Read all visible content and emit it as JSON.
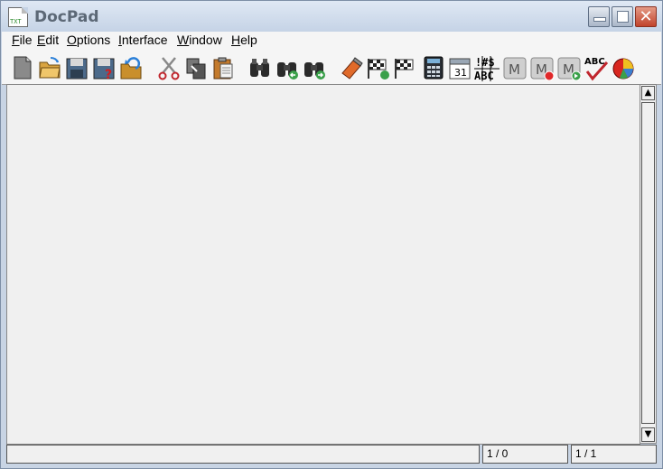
{
  "window": {
    "title": "DocPad",
    "app_icon_text": "TXT"
  },
  "menu": [
    {
      "label": "File",
      "accel": "F",
      "rest": "ile"
    },
    {
      "label": "Edit",
      "accel": "E",
      "rest": "dit"
    },
    {
      "label": "Options",
      "accel": "O",
      "rest": "ptions"
    },
    {
      "label": "Interface",
      "accel": "I",
      "rest": "nterface"
    },
    {
      "label": "Window",
      "accel": "W",
      "rest": "indow"
    },
    {
      "label": "Help",
      "accel": "H",
      "rest": "elp"
    }
  ],
  "toolbar": {
    "icons": [
      "new-document-icon",
      "open-folder-icon",
      "save-icon",
      "save-as-icon",
      "reload-icon",
      "cut-icon",
      "copy-icon",
      "paste-icon",
      "find-icon",
      "find-previous-icon",
      "find-next-icon",
      "eraser-icon",
      "goto-flag-icon",
      "flag-icon",
      "calculator-icon",
      "calendar-icon",
      "character-map-icon",
      "macro-icon",
      "macro-record-icon",
      "macro-play-icon",
      "spellcheck-icon",
      "pie-chart-icon"
    ],
    "calendar_day": "31",
    "charmap_top": "!#$",
    "charmap_bottom": "ABC",
    "macro_letter": "M",
    "spell_text": "ABC"
  },
  "statusbar": {
    "message": "",
    "position": "1 / 0",
    "page": "1 / 1"
  },
  "scrollbar": {
    "up_arrow": "▲",
    "down_arrow": "▼"
  }
}
